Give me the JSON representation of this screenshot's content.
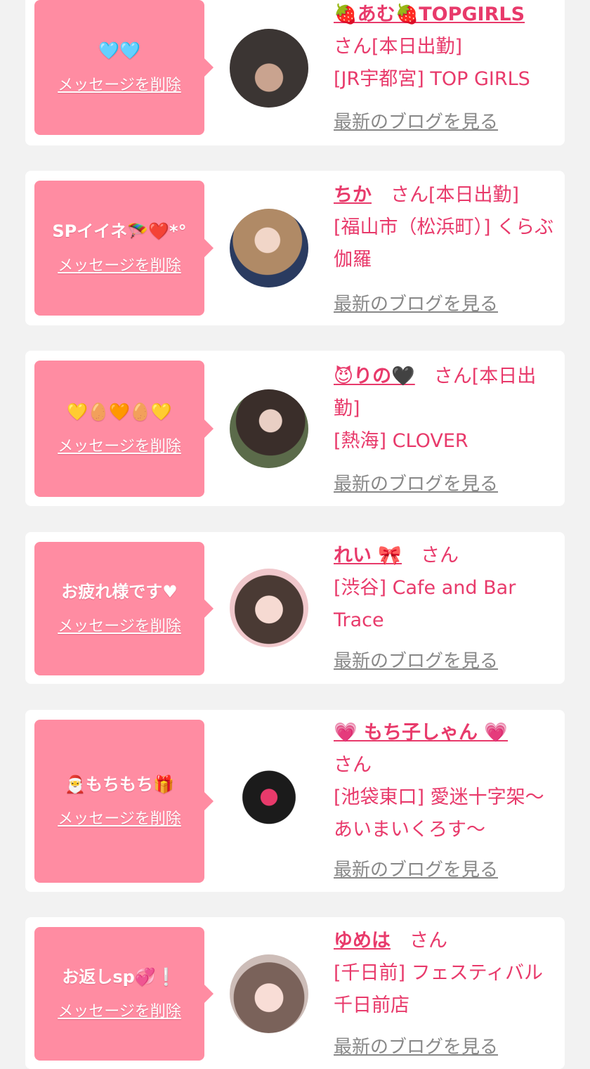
{
  "colors": {
    "accent": "#e83a6b",
    "bubble": "#ff8ca2",
    "background": "#f2f2f2",
    "link_gray": "#888888"
  },
  "common": {
    "delete_label": "メッセージを削除",
    "blog_label": "最新のブログを見る"
  },
  "cards": [
    {
      "message": "🩵🩵",
      "name": "🍓あむ🍓TOPGIRLS",
      "honorific": "さん",
      "status": "[本日出勤]",
      "shop": "[JR宇都宮] TOP GIRLS"
    },
    {
      "message": "SPイイネ🪂❤️*°",
      "name": "ちか",
      "honorific": "さん",
      "status": "[本日出勤]",
      "shop": "[福山市（松浜町）] くらぶ伽羅"
    },
    {
      "message": "💛🥚🧡🥚💛",
      "name": "😈りの🖤",
      "honorific": "さん",
      "status": "[本日出勤]",
      "shop": "[熱海] CLOVER"
    },
    {
      "message": "お疲れ様です♥",
      "name": "れい 🎀",
      "honorific": "さん",
      "status": "",
      "shop": "[渋谷] Cafe and Bar Trace"
    },
    {
      "message": "🎅もちもち🎁",
      "name": "💗 もち子しゃん 💗",
      "honorific": "さん",
      "status": "",
      "shop": "[池袋東口] 愛迷十字架〜あいまいくろす〜"
    },
    {
      "message": "お返しsp💞❕",
      "name": "ゆめは",
      "honorific": "さん",
      "status": "",
      "shop": "[千日前] フェスティバル千日前店"
    }
  ]
}
